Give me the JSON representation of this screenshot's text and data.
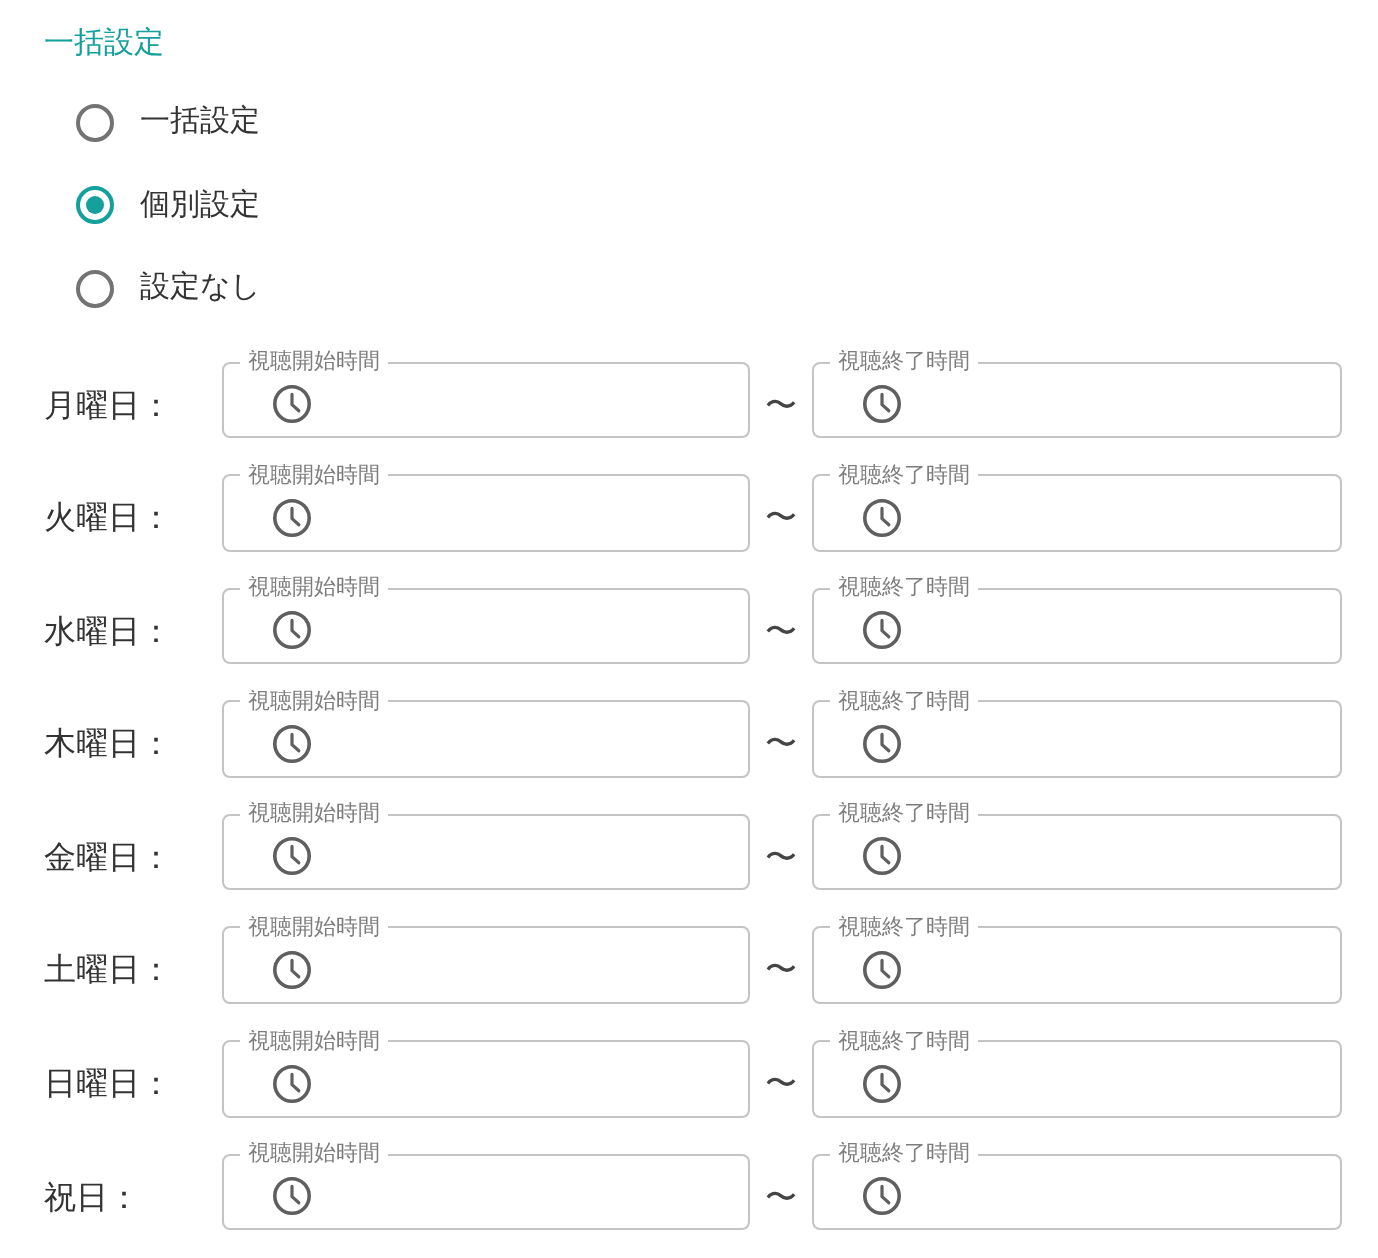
{
  "section": {
    "title": "一括設定"
  },
  "mode_options": [
    {
      "label": "一括設定",
      "selected": false
    },
    {
      "label": "個別設定",
      "selected": true
    },
    {
      "label": "設定なし",
      "selected": false
    }
  ],
  "days": [
    {
      "label": "月曜日：",
      "start": {
        "label": "視聴開始時間"
      },
      "separator": "〜",
      "end": {
        "label": "視聴終了時間"
      }
    },
    {
      "label": "火曜日：",
      "start": {
        "label": "視聴開始時間"
      },
      "separator": "〜",
      "end": {
        "label": "視聴終了時間"
      }
    },
    {
      "label": "水曜日：",
      "start": {
        "label": "視聴開始時間"
      },
      "separator": "〜",
      "end": {
        "label": "視聴終了時間"
      }
    },
    {
      "label": "木曜日：",
      "start": {
        "label": "視聴開始時間"
      },
      "separator": "〜",
      "end": {
        "label": "視聴終了時間"
      }
    },
    {
      "label": "金曜日：",
      "start": {
        "label": "視聴開始時間"
      },
      "separator": "〜",
      "end": {
        "label": "視聴終了時間"
      }
    },
    {
      "label": "土曜日：",
      "start": {
        "label": "視聴開始時間"
      },
      "separator": "〜",
      "end": {
        "label": "視聴終了時間"
      }
    },
    {
      "label": "日曜日：",
      "start": {
        "label": "視聴開始時間"
      },
      "separator": "〜",
      "end": {
        "label": "視聴終了時間"
      }
    },
    {
      "label": "祝日：",
      "start": {
        "label": "視聴開始時間"
      },
      "separator": "〜",
      "end": {
        "label": "視聴終了時間"
      }
    }
  ]
}
